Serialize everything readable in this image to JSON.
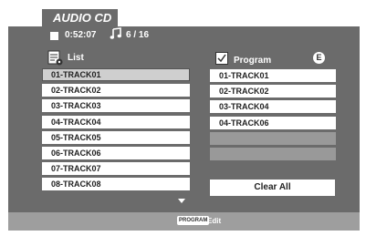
{
  "title": "AUDIO CD",
  "status": {
    "time": "0:52:07",
    "track_info": "6 / 16"
  },
  "list": {
    "header": "List",
    "tracks": [
      "01-TRACK01",
      "02-TRACK02",
      "03-TRACK03",
      "04-TRACK04",
      "05-TRACK05",
      "06-TRACK06",
      "07-TRACK07",
      "08-TRACK08"
    ]
  },
  "program": {
    "header": "Program",
    "badge": "E",
    "tracks": [
      "01-TRACK01",
      "02-TRACK02",
      "03-TRACK04",
      "04-TRACK06"
    ],
    "clear_label": "Clear All"
  },
  "footer": {
    "key_label": "PROGRAM",
    "action_label": "Edit"
  }
}
